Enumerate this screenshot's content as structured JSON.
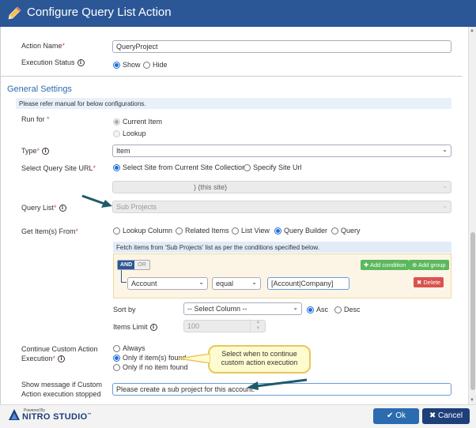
{
  "dialog": {
    "title": "Configure Query List Action"
  },
  "action_name": {
    "label": "Action Name",
    "required_mark": "*",
    "value": "QueryProject"
  },
  "execution_status": {
    "label": "Execution Status",
    "options": [
      "Show",
      "Hide"
    ],
    "selected": "Show"
  },
  "general_settings": {
    "title": "General Settings",
    "note": "Please refer manual for below configurations."
  },
  "run_for": {
    "label": "Run for",
    "required_mark": "*",
    "options": [
      "Current Item",
      "Lookup"
    ],
    "selected": "Current Item"
  },
  "type": {
    "label": "Type",
    "required_mark": "*",
    "value": "Item"
  },
  "query_site_url": {
    "label": "Select Query Site URL",
    "required_mark": "*",
    "options": [
      "Select Site from Current Site Collection",
      "Specify Site Url"
    ],
    "selected": "Select Site from Current Site Collection",
    "site_value": ") (this site)"
  },
  "query_list": {
    "label": "Query List",
    "required_mark": "*",
    "value": "Sub Projects"
  },
  "get_items_from": {
    "label": "Get Item(s) From",
    "required_mark": "*",
    "options": [
      "Lookup Column",
      "Related Items",
      "List View",
      "Query Builder",
      "Query"
    ],
    "selected": "Query Builder"
  },
  "query_builder": {
    "header": "Fetch items from 'Sub Projects' list as per the conditions specified below.",
    "and_label": "AND",
    "or_label": "OR",
    "add_condition": "Add condition",
    "add_group": "Add group",
    "condition": {
      "field": "Account",
      "operator": "equal",
      "value": "[Account|Company]"
    },
    "delete_label": "Delete"
  },
  "sort_by": {
    "label": "Sort by",
    "column_placeholder": "-- Select Column --",
    "options": [
      "Asc",
      "Desc"
    ],
    "selected": "Asc"
  },
  "items_limit": {
    "label": "Items Limit",
    "value": "100"
  },
  "continue_execution": {
    "label_line1": "Continue Custom Action",
    "label_line2": "Execution",
    "required_mark": "*",
    "options": [
      "Always",
      "Only if item(s) found",
      "Only if no item found"
    ],
    "selected": "Only if item(s) found"
  },
  "callout": {
    "text_line1": "Select when to continue",
    "text_line2": "custom action execution"
  },
  "stop_message": {
    "label_line1": "Show message if Custom",
    "label_line2": "Action execution stopped",
    "value": "Please create a sub project for this account."
  },
  "footer": {
    "powered_by": "Powered By",
    "brand": "NITRO STUDIO",
    "brand_tm": "™",
    "ok_label": "Ok",
    "cancel_label": "Cancel"
  },
  "colors": {
    "title_bar": "#2b5797",
    "accent": "#1e6fd9",
    "green": "#5cb85c",
    "red": "#d9534f",
    "arrow": "#1f5a68"
  }
}
